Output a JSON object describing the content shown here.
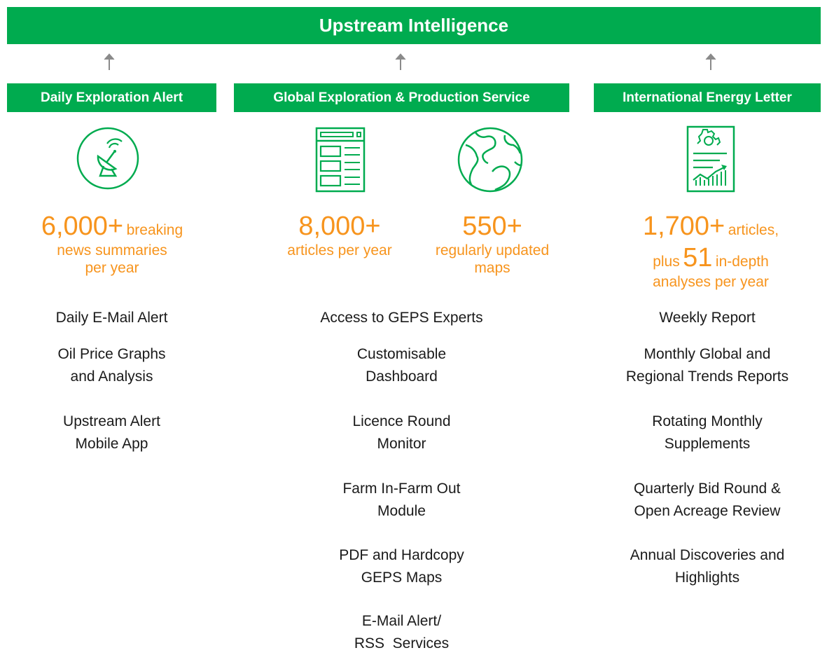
{
  "title": "Upstream Intelligence",
  "columns": [
    {
      "header": "Daily Exploration Alert",
      "icon": "satellite-dish-icon",
      "features": [
        "Daily E-Mail Alert",
        "Oil Price Graphs",
        "and Analysis",
        "Upstream Alert",
        "Mobile App"
      ]
    },
    {
      "header": "Global Exploration & Production Service",
      "icons": [
        "document-layout-icon",
        "globe-icon"
      ],
      "features": [
        "Access to GEPS Experts",
        "Customisable",
        "Dashboard",
        "Licence Round",
        "Monitor",
        "Farm In-Farm Out",
        "Module",
        "PDF and Hardcopy",
        "GEPS Maps",
        "E-Mail Alert/",
        "RSS  Services"
      ]
    },
    {
      "header": "International Energy Letter",
      "icon": "report-chart-icon",
      "features": [
        "Weekly Report",
        "Monthly Global and",
        "Regional Trends Reports",
        "Rotating Monthly",
        "Supplements",
        "Quarterly Bid Round &",
        "Open Acreage Review",
        "Annual Discoveries and",
        "Highlights"
      ]
    }
  ],
  "stats": {
    "dea_number": "6,000+",
    "dea_line1_rest": "breaking",
    "dea_line2": "news summaries",
    "dea_line3": "per year",
    "geps_articles_number": "8,000+",
    "geps_articles_label": "articles per year",
    "geps_maps_number": "550+",
    "geps_maps_line1": "regularly updated",
    "geps_maps_line2": "maps",
    "iel_number": "1,700+",
    "iel_line1_rest": "articles,",
    "iel_plus": "plus",
    "iel_number2": "51",
    "iel_line2_rest": "in-depth",
    "iel_line3": "analyses per year"
  },
  "colors": {
    "green": "#00ab4f",
    "orange": "#f7941d",
    "arrow": "#8a8a8a"
  }
}
